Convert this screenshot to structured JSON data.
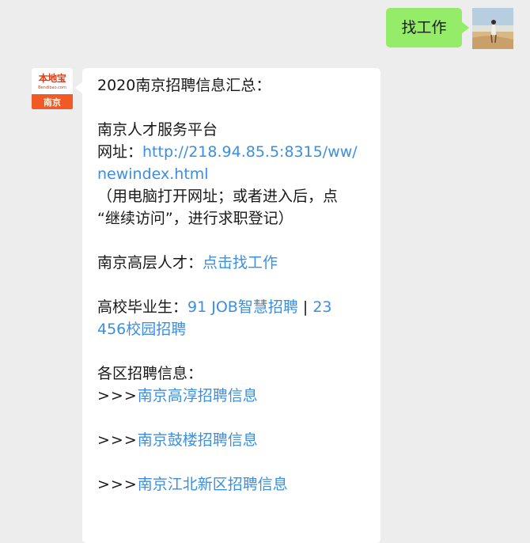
{
  "outgoing": {
    "text": "找工作"
  },
  "brand": {
    "logo_text": "本地宝",
    "url_text": "Bendibao.com",
    "city": "南京"
  },
  "message": {
    "title": "2020南京招聘信息汇总：",
    "platform_name": "南京人才服务平台",
    "url_label": "网址：",
    "url_part1": "http://218.94.85.5:8315/ww/",
    "url_part2": "newindex.html",
    "note_line1": "（用电脑打开网址；或者进入后，点",
    "note_line2": "“继续访问”，进行求职登记）",
    "high_talent_label": "南京高层人才：",
    "high_talent_link": "点击找工作",
    "graduates_label": "高校毕业生：",
    "graduates_link1": "91 JOB智慧招聘",
    "separator": " | ",
    "graduates_link2_part1": "23",
    "graduates_link2_part2": "456校园招聘",
    "district_label": "各区招聘信息：",
    "arrows": ">>>",
    "district_links": [
      "南京高淳招聘信息",
      "南京鼓楼招聘信息",
      "南京江北新区招聘信息"
    ]
  },
  "colors": {
    "background": "#ededed",
    "outgoing_bubble": "#95ec69",
    "incoming_bubble": "#ffffff",
    "link": "#3c8fe0",
    "brand_orange": "#f15a24"
  }
}
